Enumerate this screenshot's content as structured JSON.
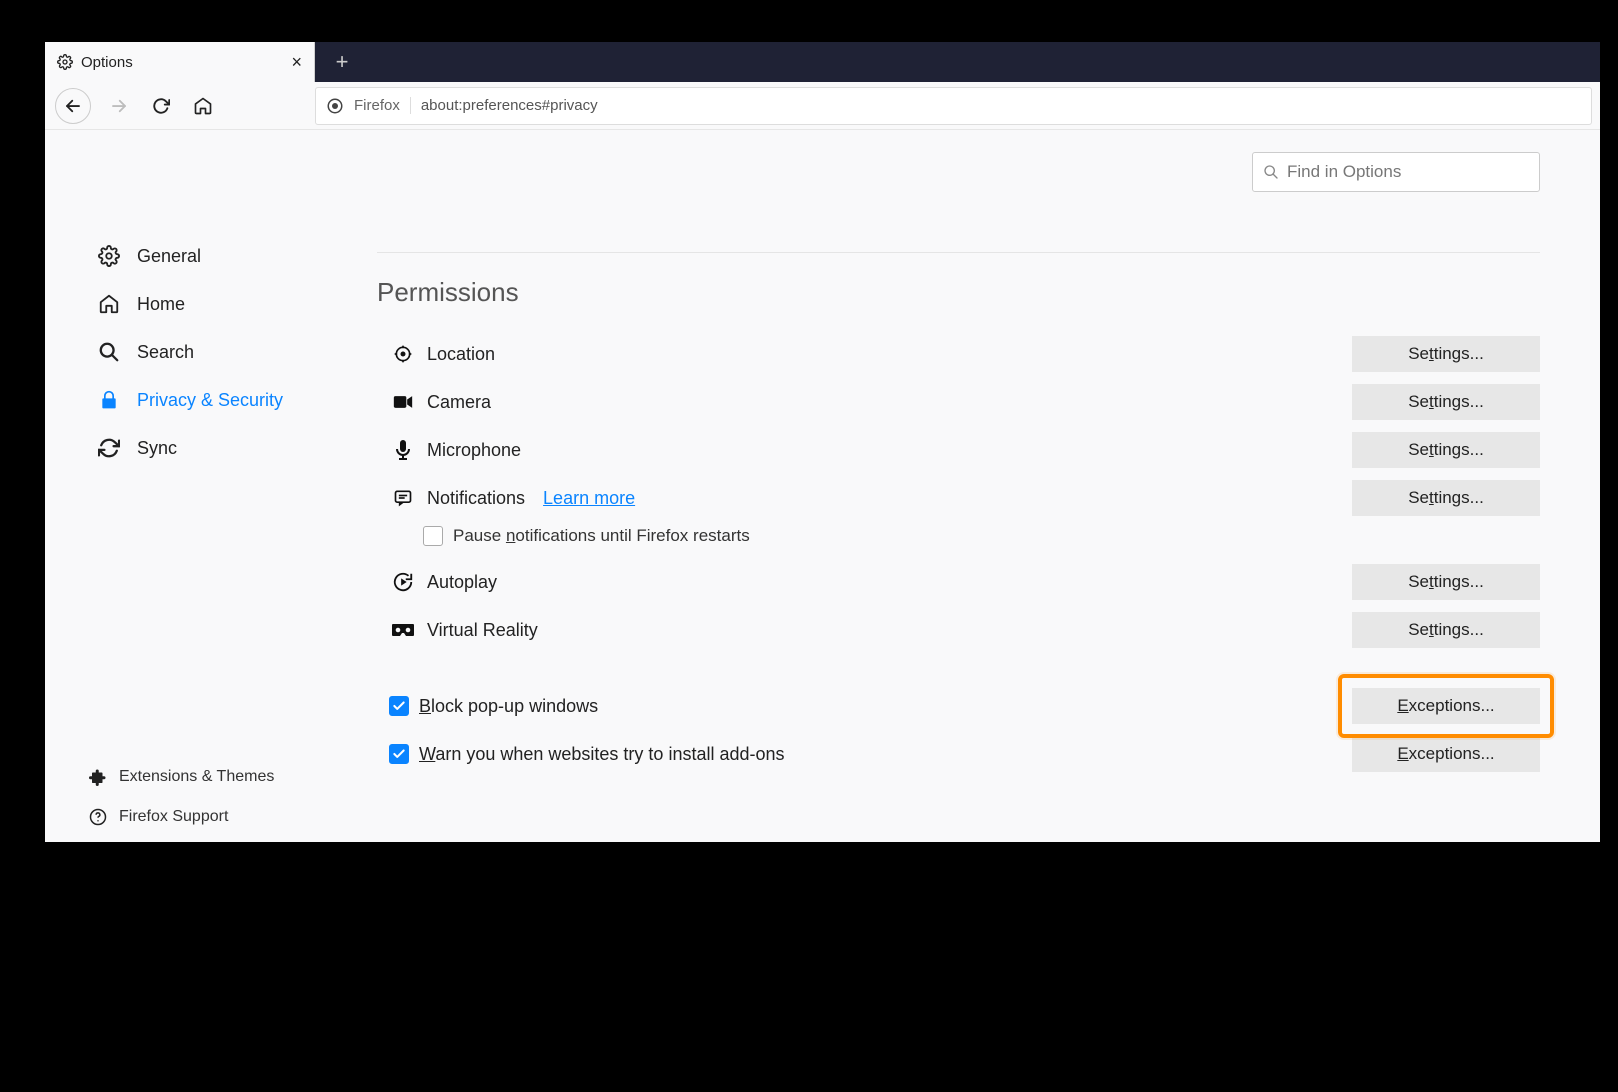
{
  "tab": {
    "title": "Options"
  },
  "urlbar": {
    "identity": "Firefox",
    "url": "about:preferences#privacy"
  },
  "search": {
    "placeholder": "Find in Options"
  },
  "sidebar": {
    "items": [
      {
        "label": "General"
      },
      {
        "label": "Home"
      },
      {
        "label": "Search"
      },
      {
        "label": "Privacy & Security"
      },
      {
        "label": "Sync"
      }
    ],
    "bottom": [
      {
        "label": "Extensions & Themes"
      },
      {
        "label": "Firefox Support"
      }
    ]
  },
  "section": {
    "title": "Permissions"
  },
  "permissions": {
    "location": {
      "label": "Location",
      "button": "Settings..."
    },
    "camera": {
      "label": "Camera",
      "button": "Settings..."
    },
    "microphone": {
      "label": "Microphone",
      "button": "Settings..."
    },
    "notifications": {
      "label": "Notifications",
      "link": "Learn more",
      "button": "Settings...",
      "pause": "Pause notifications until Firefox restarts"
    },
    "autoplay": {
      "label": "Autoplay",
      "button": "Settings..."
    },
    "vr": {
      "label": "Virtual Reality",
      "button": "Settings..."
    },
    "popups": {
      "label": "Block pop-up windows",
      "button": "Exceptions...",
      "checked": true
    },
    "addons": {
      "label": "Warn you when websites try to install add-ons",
      "button": "Exceptions...",
      "checked": true
    }
  }
}
